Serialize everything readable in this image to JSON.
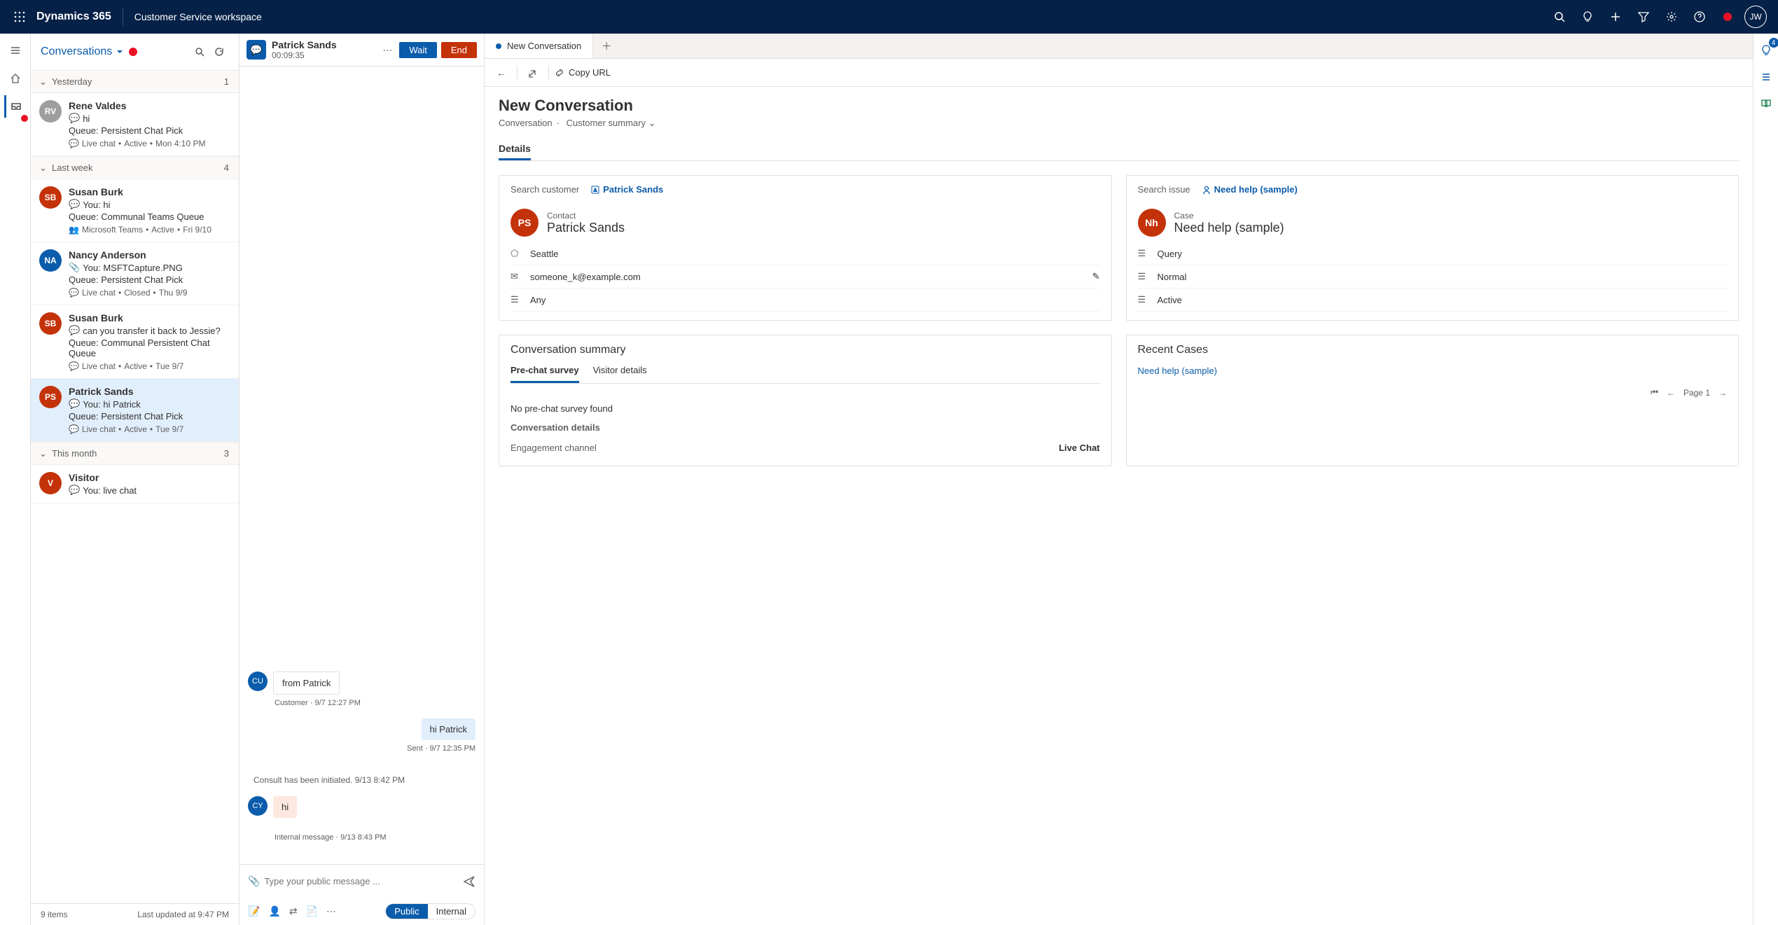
{
  "topnav": {
    "brand": "Dynamics 365",
    "workspace": "Customer Service workspace",
    "user_initials": "JW"
  },
  "conv_header": {
    "title": "Conversations"
  },
  "conv_groups": [
    {
      "label": "Yesterday",
      "count": "1"
    },
    {
      "label": "Last week",
      "count": "4"
    },
    {
      "label": "This month",
      "count": "3"
    }
  ],
  "conversations": [
    {
      "avatar": "RV",
      "color": "#9e9e9e",
      "name": "Rene Valdes",
      "preview": "hi",
      "queue": "Queue: Persistent Chat Pick",
      "channel": "Live chat",
      "status": "Active",
      "time": "Mon 4:10 PM",
      "icon": "chat"
    },
    {
      "avatar": "SB",
      "color": "#c4320a",
      "name": "Susan Burk",
      "preview": "You: hi",
      "queue": "Queue: Communal Teams Queue",
      "channel": "Microsoft Teams",
      "status": "Active",
      "time": "Fri 9/10",
      "icon": "chat"
    },
    {
      "avatar": "NA",
      "color": "#0b5cab",
      "name": "Nancy Anderson",
      "preview": "You: MSFTCapture.PNG",
      "queue": "Queue: Persistent Chat Pick",
      "channel": "Live chat",
      "status": "Closed",
      "time": "Thu 9/9",
      "icon": "attach"
    },
    {
      "avatar": "SB",
      "color": "#c4320a",
      "name": "Susan Burk",
      "preview": "can you transfer it back to Jessie?",
      "queue": "Queue: Communal Persistent Chat Queue",
      "channel": "Live chat",
      "status": "Active",
      "time": "Tue 9/7",
      "icon": "chat"
    },
    {
      "avatar": "PS",
      "color": "#c4320a",
      "name": "Patrick Sands",
      "preview": "You: hi Patrick",
      "queue": "Queue: Persistent Chat Pick",
      "channel": "Live chat",
      "status": "Active",
      "time": "Tue 9/7",
      "icon": "chat"
    },
    {
      "avatar": "V",
      "color": "#c4320a",
      "name": "Visitor",
      "preview": "You: live chat",
      "queue": "",
      "channel": "",
      "status": "",
      "time": "",
      "icon": "chat"
    }
  ],
  "conv_footer": {
    "count": "9 items",
    "updated": "Last updated at 9:47 PM"
  },
  "chat_header": {
    "name": "Patrick Sands",
    "timer": "00:09:35",
    "wait_btn": "Wait",
    "end_btn": "End"
  },
  "chat_messages": [
    {
      "type": "incoming",
      "avatar": "CU",
      "color": "#0b5cab",
      "text": "from Patrick",
      "meta": "Customer · 9/7 12:27 PM"
    },
    {
      "type": "outgoing",
      "text": "hi Patrick",
      "meta": "Sent · 9/7 12:35 PM"
    },
    {
      "type": "system",
      "text": "Consult has been initiated. 9/13 8:42 PM"
    },
    {
      "type": "internal",
      "avatar": "CY",
      "color": "#0b5cab",
      "text": "hi",
      "meta": "Internal message · 9/13 8:43 PM"
    }
  ],
  "chat_input": {
    "placeholder": "Type your public message ...",
    "public_label": "Public",
    "internal_label": "Internal"
  },
  "tabs": {
    "new_conv": "New Conversation"
  },
  "cmdrow": {
    "copy_url": "Copy URL"
  },
  "detail": {
    "title": "New Conversation",
    "crumb1": "Conversation",
    "crumb2": "Customer summary",
    "section_details": "Details"
  },
  "customer_panel": {
    "search_label": "Search customer",
    "link": "Patrick Sands",
    "contact_type": "Contact",
    "contact_name": "Patrick Sands",
    "avatar": "PS",
    "city": "Seattle",
    "email": "someone_k@example.com",
    "pref": "Any"
  },
  "issue_panel": {
    "search_label": "Search issue",
    "link": "Need help (sample)",
    "case_type": "Case",
    "case_name": "Need help (sample)",
    "avatar": "Nh",
    "type": "Query",
    "priority": "Normal",
    "status": "Active"
  },
  "summary_panel": {
    "title": "Conversation summary",
    "tab_prechat": "Pre-chat survey",
    "tab_visitor": "Visitor details",
    "empty": "No pre-chat survey found",
    "details_label": "Conversation details",
    "field_channel_label": "Engagement channel",
    "field_channel_value": "Live Chat"
  },
  "recent_panel": {
    "title": "Recent Cases",
    "items": [
      "Need help (sample)"
    ],
    "page_label": "Page 1"
  },
  "right_rail_badge": "4"
}
